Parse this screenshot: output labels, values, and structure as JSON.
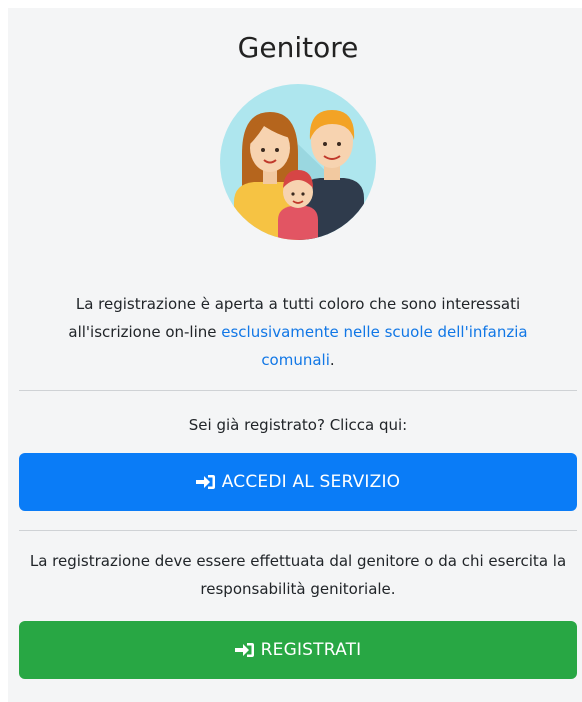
{
  "section_title": "Genitore",
  "intro": {
    "text_before": "La registrazione è aperta a tutti coloro che sono interessati all'iscrizione on-line ",
    "link_text": "esclusivamente nelle scuole dell'infanzia comunali",
    "text_after": "."
  },
  "login_prompt": "Sei già registrato? Clicca qui:",
  "login_button_label": "ACCEDI AL SERVIZIO",
  "register_note": "La registrazione deve essere effettuata dal genitore o da chi esercita la responsabilità genitoriale.",
  "register_button_label": "REGISTRATI",
  "icons": {
    "family": "family-illustration",
    "login": "sign-in-icon",
    "register": "sign-in-icon"
  },
  "colors": {
    "primary": "#0a7cf7",
    "success": "#28a744",
    "link": "#1177e6"
  }
}
